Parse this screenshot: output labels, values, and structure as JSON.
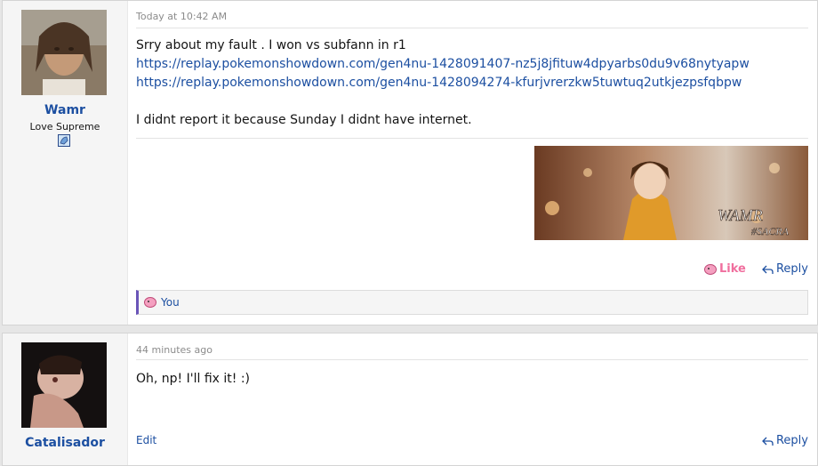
{
  "posts": [
    {
      "user": {
        "name": "Wamr",
        "title": "Love Supreme",
        "badge_icon": "pokemon-badge-icon"
      },
      "timestamp": "Today at 10:42 AM",
      "lines": [
        "Srry about my fault . I won vs subfann in r1",
        "https://replay.pokemonshowdown.com/gen4nu-1428091407-nz5j8jfituw4dpyarbs0du9v68nytyapw",
        "https://replay.pokemonshowdown.com/gen4nu-1428094274-kfurjvrerzkw5tuwtuq2utkjezpsfqbpw",
        "",
        "I didnt report it because Sunday I didnt have internet."
      ],
      "signature": {
        "text_main": "WAMR",
        "text_sub": "#SACRA"
      },
      "actions": {
        "like": "Like",
        "reply": "Reply"
      },
      "likes": {
        "text": "You"
      }
    },
    {
      "user": {
        "name": "Catalisador"
      },
      "timestamp": "44 minutes ago",
      "lines": [
        "Oh, np! I'll fix it! :)"
      ],
      "actions": {
        "edit": "Edit",
        "reply": "Reply"
      }
    }
  ],
  "colors": {
    "link": "#1c4fa1",
    "like": "#f06f9e",
    "likes_bar_accent": "#6a55b8"
  }
}
